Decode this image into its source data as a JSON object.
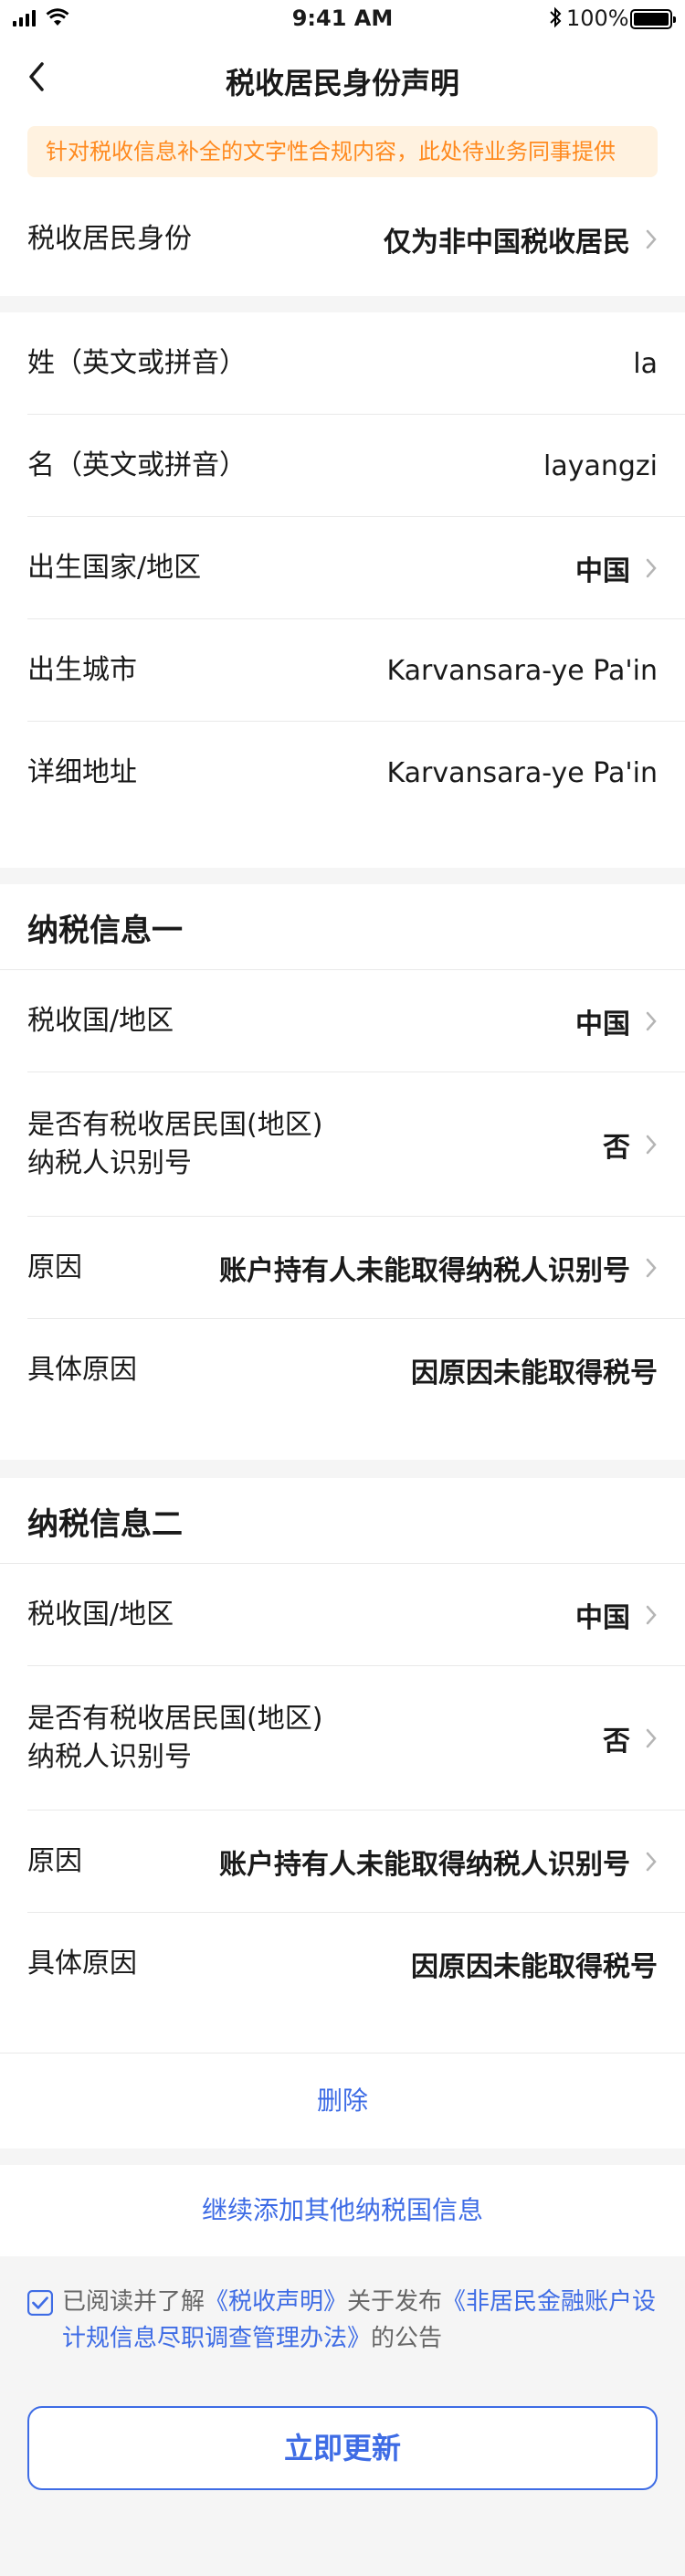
{
  "status_bar": {
    "time": "9:41 AM",
    "battery": "100%"
  },
  "nav": {
    "title": "税收居民身份声明"
  },
  "notice": "针对税收信息补全的文字性合规内容，此处待业务同事提供",
  "residency": {
    "label": "税收居民身份",
    "value": "仅为非中国税收居民"
  },
  "personal": [
    {
      "label": "姓（英文或拼音）",
      "value": "la"
    },
    {
      "label": "名（英文或拼音）",
      "value": "layangzi"
    },
    {
      "label": "出生国家/地区",
      "value": "中国"
    },
    {
      "label": "出生城市",
      "value": "Karvansara-ye Pa'in"
    },
    {
      "label": "详细地址",
      "value": "Karvansara-ye Pa'in"
    }
  ],
  "tax_info_1": {
    "title": "纳税信息一",
    "rows": [
      {
        "label": "税收国/地区",
        "value": "中国"
      },
      {
        "label_line1": "是否有税收居民国(地区)",
        "label_line2": "纳税人识别号",
        "value": "否"
      },
      {
        "label": "原因",
        "value": "账户持有人未能取得纳税人识别号"
      },
      {
        "label": "具体原因",
        "value": "因原因未能取得税号"
      }
    ]
  },
  "tax_info_2": {
    "title": "纳税信息二",
    "rows": [
      {
        "label": "税收国/地区",
        "value": "中国"
      },
      {
        "label_line1": "是否有税收居民国(地区)",
        "label_line2": "纳税人识别号",
        "value": "否"
      },
      {
        "label": "原因",
        "value": "账户持有人未能取得纳税人识别号"
      },
      {
        "label": "具体原因",
        "value": "因原因未能取得税号"
      }
    ]
  },
  "delete_label": "删除",
  "add_more_label": "继续添加其他纳税国信息",
  "agreement": {
    "prefix": "已阅读并了解",
    "link1": "《税收声明》",
    "middle": "关于发布",
    "link2": "《非居民金融账户设计规信息尽职调查管理办法》",
    "suffix": "的公告"
  },
  "submit_label": "立即更新",
  "colors": {
    "accent": "#3e6ce5",
    "notice_text": "#ff8a1f",
    "notice_bg": "#fff2e0",
    "page_bg": "#f5f5f5"
  }
}
